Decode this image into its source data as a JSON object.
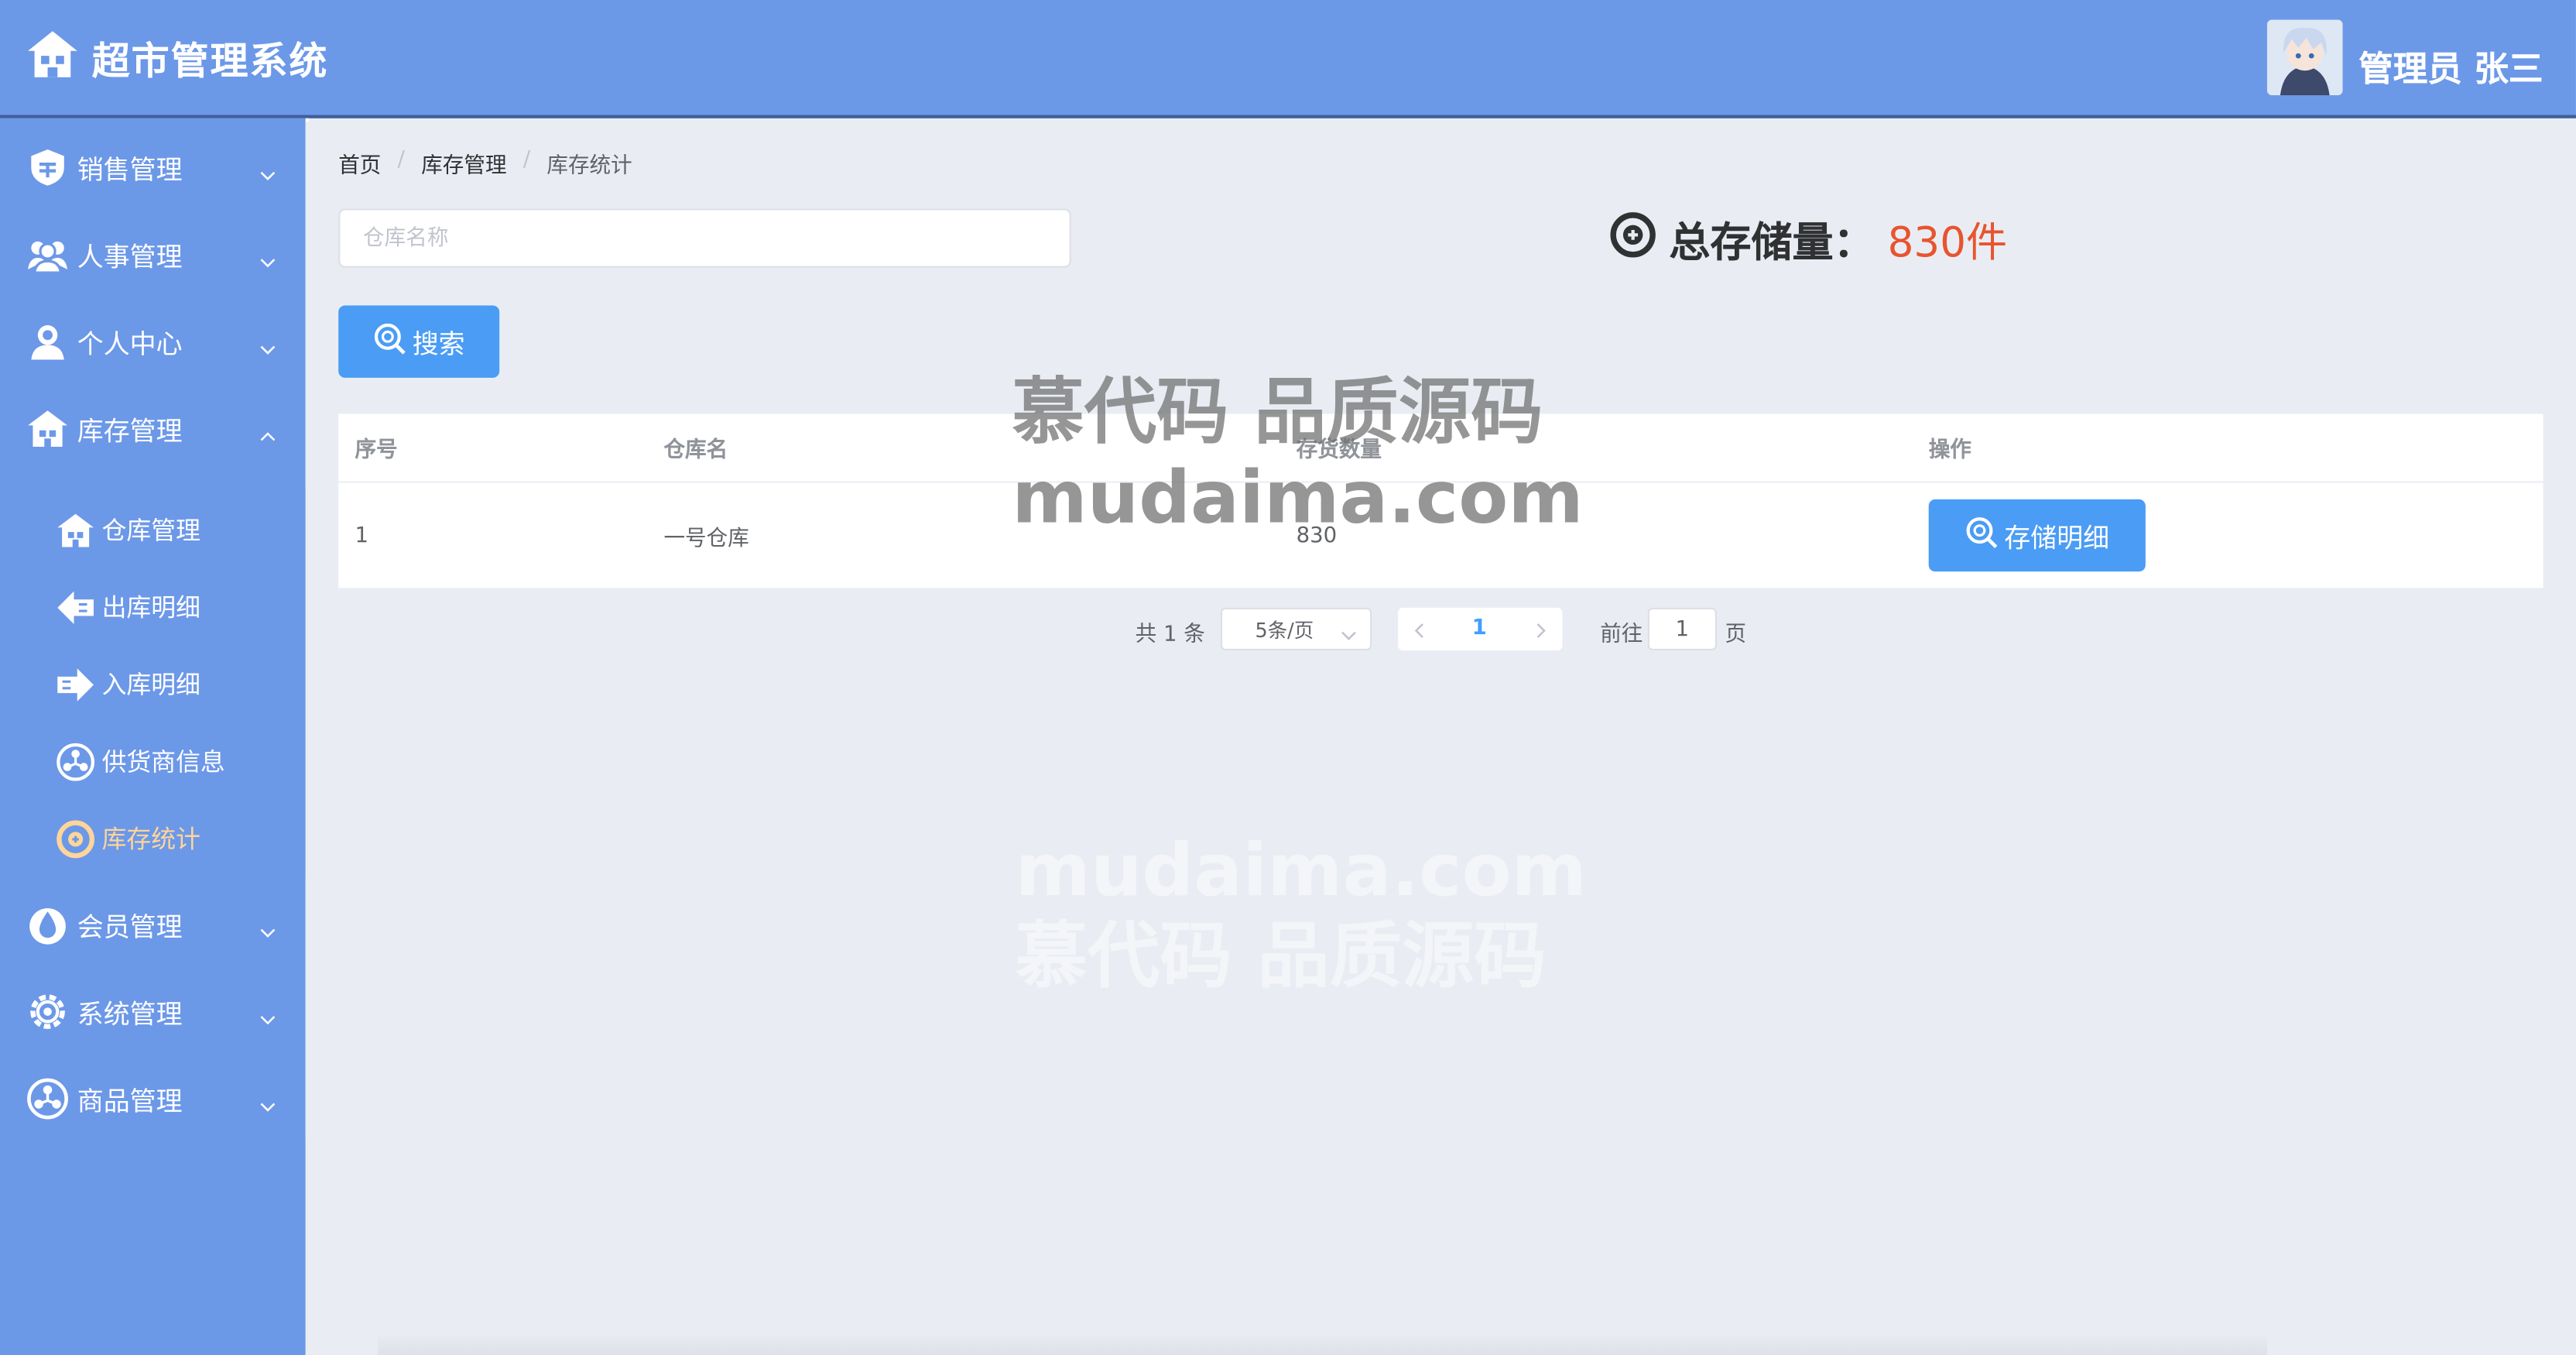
{
  "app": {
    "title": "超市管理系统"
  },
  "user": {
    "name": "管理员 张三"
  },
  "sidebar": {
    "items": [
      {
        "label": "销售管理",
        "icon": "shield-icon"
      },
      {
        "label": "人事管理",
        "icon": "users-icon"
      },
      {
        "label": "个人中心",
        "icon": "user-icon"
      },
      {
        "label": "库存管理",
        "icon": "warehouse-icon",
        "expanded": true
      },
      {
        "label": "会员管理",
        "icon": "drop-icon"
      },
      {
        "label": "系统管理",
        "icon": "gear-icon"
      },
      {
        "label": "商品管理",
        "icon": "product-icon"
      }
    ],
    "sub_items": [
      {
        "label": "仓库管理",
        "icon": "warehouse-icon"
      },
      {
        "label": "出库明细",
        "icon": "arrow-left-icon"
      },
      {
        "label": "入库明细",
        "icon": "arrow-right-icon"
      },
      {
        "label": "供货商信息",
        "icon": "supplier-icon"
      },
      {
        "label": "库存统计",
        "icon": "stats-icon",
        "active": true
      }
    ]
  },
  "breadcrumb": [
    "首页",
    "库存管理",
    "库存统计"
  ],
  "search": {
    "placeholder": "仓库名称",
    "value": "",
    "button_label": "搜索"
  },
  "summary": {
    "label": "总存储量：",
    "value": "830件"
  },
  "table": {
    "headers": [
      "序号",
      "仓库名",
      "存货数量",
      "操作"
    ],
    "rows": [
      {
        "index": "1",
        "name": "一号仓库",
        "quantity": "830",
        "action": "存储明细"
      }
    ]
  },
  "pagination": {
    "total": "共 1 条",
    "page_size": "5条/页",
    "current": "1",
    "goto_label": "前往",
    "goto_value": "1",
    "page_label": "页"
  },
  "watermark": {
    "line1": "慕代码 品质源码",
    "line2": "mudaima.com"
  },
  "colors": {
    "primary": "#6c98e8",
    "button": "#4a9cf5",
    "active_menu": "#ffd59a",
    "total_value": "#e8542f"
  }
}
